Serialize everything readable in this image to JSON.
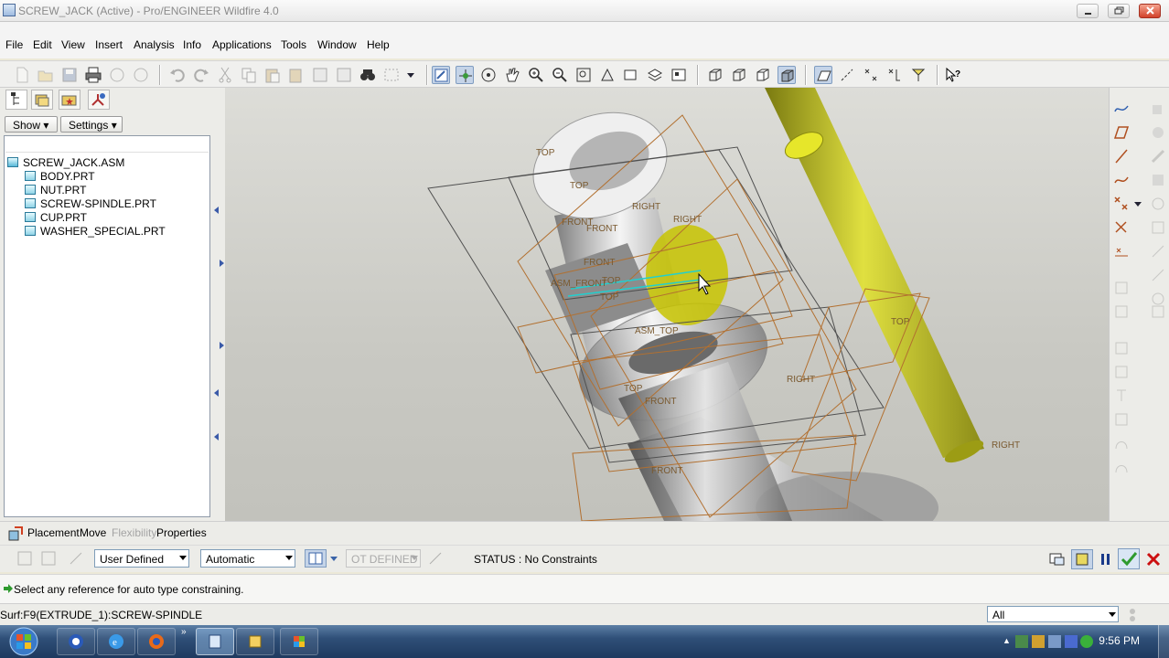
{
  "window": {
    "title": "SCREW_JACK (Active) - Pro/ENGINEER Wildfire 4.0"
  },
  "menu": [
    "File",
    "Edit",
    "View",
    "Insert",
    "Analysis",
    "Info",
    "Applications",
    "Tools",
    "Window",
    "Help"
  ],
  "left_panel": {
    "show_label": "Show",
    "settings_label": "Settings",
    "tree": [
      {
        "label": "SCREW_JACK.ASM",
        "kind": "asm"
      },
      {
        "label": "BODY.PRT",
        "kind": "prt"
      },
      {
        "label": "NUT.PRT",
        "kind": "prt"
      },
      {
        "label": "SCREW-SPINDLE.PRT",
        "kind": "prt"
      },
      {
        "label": "CUP.PRT",
        "kind": "prt"
      },
      {
        "label": "WASHER_SPECIAL.PRT",
        "kind": "prt"
      }
    ]
  },
  "viewport": {
    "datum_labels": [
      "TOP",
      "TOP",
      "FRONT",
      "FRONT",
      "RIGHT",
      "RIGHT",
      "FRONT",
      "ASM_FRONT",
      "TOP",
      "TOP",
      "ASM_TOP",
      "TOP",
      "RIGHT",
      "TOP",
      "FRONT",
      "FRONT",
      "RIGHT"
    ],
    "highlight_color": "#c8c400",
    "part_color": "#c8c82a"
  },
  "dashboard": {
    "tabs": {
      "placement": "Placement",
      "move": "Move",
      "flexibility": "Flexibility",
      "properties": "Properties"
    },
    "constraint_set": "User Defined",
    "constraint_type": "Automatic",
    "offset_value": "OT DEFINED",
    "status": "STATUS : No Constraints"
  },
  "message": "Select any reference for auto type constraining.",
  "statusbar": {
    "selection": "Surf:F9(EXTRUDE_1):SCREW-SPINDLE",
    "filter": "All"
  },
  "taskbar": {
    "time": "9:56 PM"
  },
  "colors": {
    "accept": "#2e9a2e",
    "cancel": "#cc1010",
    "taskbar": "#2f4f78"
  }
}
